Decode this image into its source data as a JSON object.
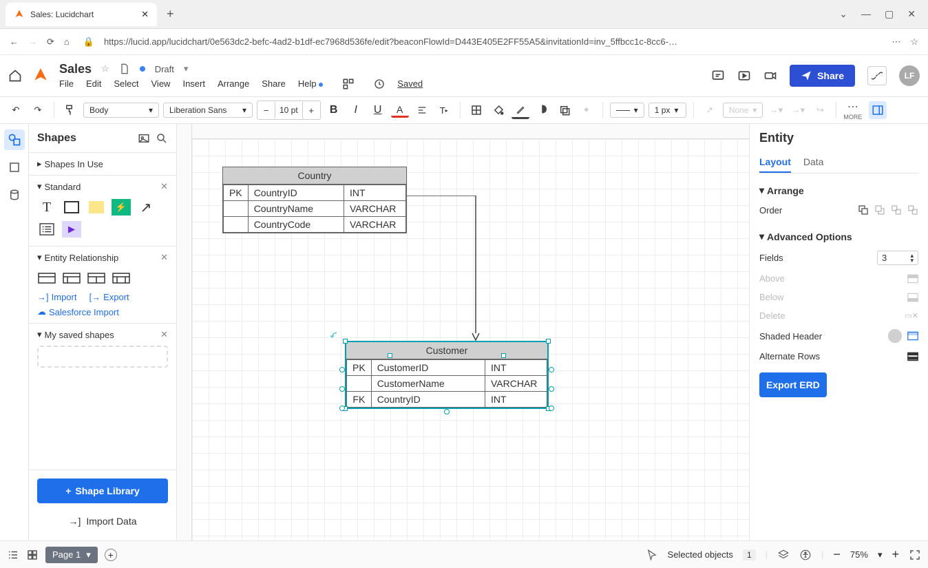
{
  "browser": {
    "tab_title": "Sales: Lucidchart",
    "url": "https://lucid.app/lucidchart/0e563dc2-befc-4ad2-b1df-ec7968d536fe/edit?beaconFlowId=D443E405E2FF55A5&invitationId=inv_5ffbcc1c-8cc6-…"
  },
  "header": {
    "doc_title": "Sales",
    "status": "Draft",
    "saved_label": "Saved",
    "menus": [
      "File",
      "Edit",
      "Select",
      "View",
      "Insert",
      "Arrange",
      "Share",
      "Help"
    ],
    "share_label": "Share",
    "avatar": "LF"
  },
  "toolbar": {
    "style_select": "Body",
    "font_select": "Liberation Sans",
    "font_size": "10 pt",
    "line_width": "1 px",
    "line_style_none": "None",
    "more_label": "MORE"
  },
  "shapes_panel": {
    "title": "Shapes",
    "sections": {
      "in_use": "Shapes In Use",
      "standard": "Standard",
      "er": "Entity Relationship",
      "saved": "My saved shapes"
    },
    "import": "Import",
    "export": "Export",
    "salesforce": "Salesforce Import",
    "shape_library": "Shape Library",
    "import_data": "Import Data"
  },
  "canvas": {
    "entity1": {
      "name": "Country",
      "rows": [
        {
          "key": "PK",
          "field": "CountryID",
          "type": "INT"
        },
        {
          "key": "",
          "field": "CountryName",
          "type": "VARCHAR"
        },
        {
          "key": "",
          "field": "CountryCode",
          "type": "VARCHAR"
        }
      ]
    },
    "entity2": {
      "name": "Customer",
      "rows": [
        {
          "key": "PK",
          "field": "CustomerID",
          "type": "INT"
        },
        {
          "key": "",
          "field": "CustomerName",
          "type": "VARCHAR"
        },
        {
          "key": "FK",
          "field": "CountryID",
          "type": "INT"
        }
      ]
    }
  },
  "right_panel": {
    "title": "Entity",
    "tabs": {
      "layout": "Layout",
      "data": "Data"
    },
    "arrange": "Arrange",
    "order": "Order",
    "advanced": "Advanced Options",
    "fields": "Fields",
    "fields_value": "3",
    "above": "Above",
    "below": "Below",
    "delete": "Delete",
    "shaded_header": "Shaded Header",
    "alternate_rows": "Alternate Rows",
    "export_erd": "Export ERD"
  },
  "statusbar": {
    "page": "Page 1",
    "selected": "Selected objects",
    "selected_count": "1",
    "zoom": "75%"
  }
}
